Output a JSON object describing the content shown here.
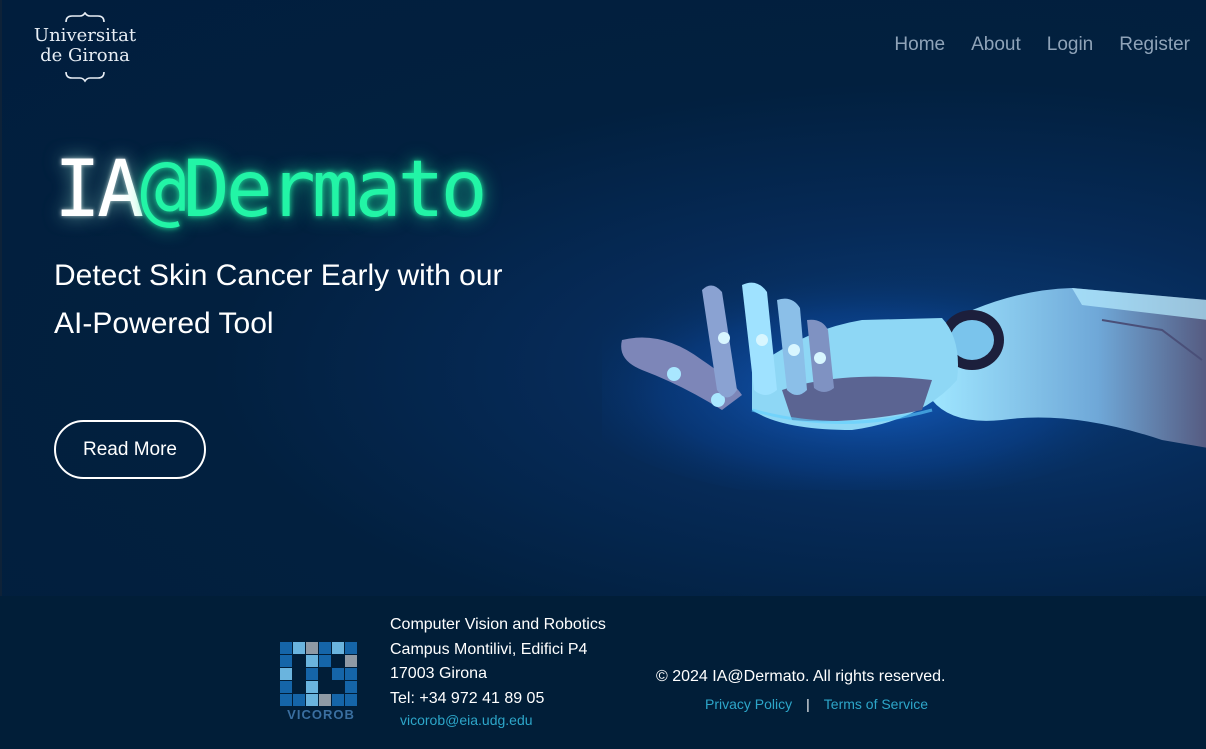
{
  "header": {
    "logo_line1": "Universitat",
    "logo_line2": "de Girona",
    "nav": {
      "home": "Home",
      "about": "About",
      "login": "Login",
      "register": "Register"
    }
  },
  "hero": {
    "title_prefix": "IA",
    "title_suffix": "@Dermato",
    "subtitle": "Detect Skin Cancer Early with our AI-Powered Tool",
    "read_more": "Read More",
    "accent_color": "#22f5a6"
  },
  "footer": {
    "org_logo_label": "VICOROB",
    "address_line1": "Computer Vision and Robotics",
    "address_line2": "Campus Montilivi, Edifici P4",
    "address_line3": "17003 Girona",
    "phone": "Tel: +34 972 41 89 05",
    "email": "vicorob@eia.udg.edu",
    "copyright": "© 2024 IA@Dermato. All rights reserved.",
    "privacy": "Privacy Policy",
    "separator": "|",
    "terms": "Terms of Service"
  }
}
